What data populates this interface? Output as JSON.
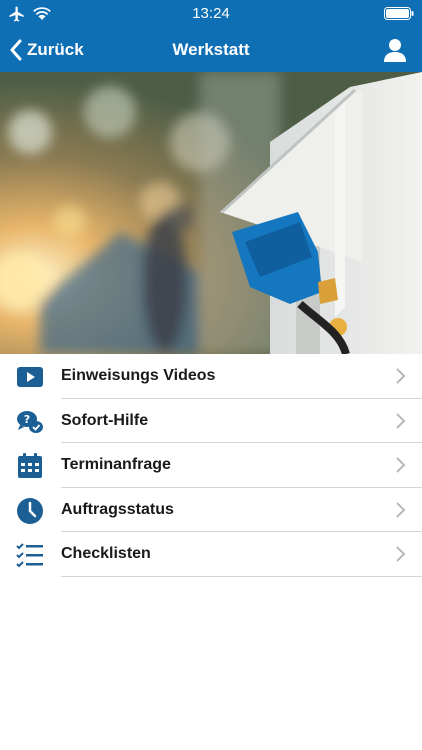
{
  "status_bar": {
    "time": "13:24"
  },
  "nav": {
    "back_label": "Zurück",
    "title": "Werkstatt"
  },
  "menu": {
    "items": [
      {
        "label": "Einweisungs Videos",
        "icon": "video-play-icon"
      },
      {
        "label": "Sofort-Hilfe",
        "icon": "help-chat-icon"
      },
      {
        "label": "Terminanfrage",
        "icon": "calendar-icon"
      },
      {
        "label": "Auftragsstatus",
        "icon": "clock-icon"
      },
      {
        "label": "Checklisten",
        "icon": "checklist-icon"
      }
    ]
  },
  "colors": {
    "brand_blue": "#0e6fb5",
    "icon_blue": "#1b5f95",
    "chevron": "#b8b8b8",
    "separator": "#d5d5d5"
  }
}
